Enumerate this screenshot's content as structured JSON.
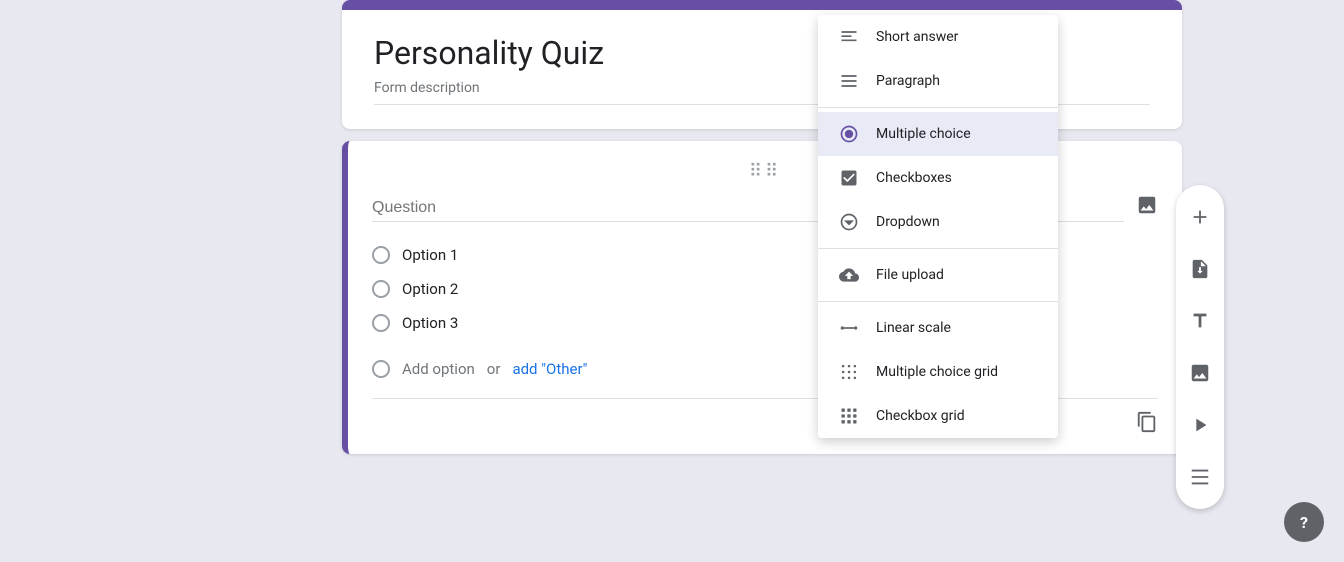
{
  "header": {
    "title": "Personality Quiz",
    "description": "Form description"
  },
  "question": {
    "placeholder": "Question",
    "drag_dots": "⠿",
    "options": [
      {
        "label": "Option 1"
      },
      {
        "label": "Option 2"
      },
      {
        "label": "Option 3"
      }
    ],
    "add_option_text": "Add option",
    "add_option_or": "or",
    "add_other_text": "add \"Other\""
  },
  "dropdown_menu": {
    "items": [
      {
        "id": "short-answer",
        "label": "Short answer",
        "icon": "short-answer-icon"
      },
      {
        "id": "paragraph",
        "label": "Paragraph",
        "icon": "paragraph-icon"
      },
      {
        "id": "multiple-choice",
        "label": "Multiple choice",
        "icon": "multiple-choice-icon",
        "selected": true
      },
      {
        "id": "checkboxes",
        "label": "Checkboxes",
        "icon": "checkboxes-icon"
      },
      {
        "id": "dropdown",
        "label": "Dropdown",
        "icon": "dropdown-icon"
      },
      {
        "id": "file-upload",
        "label": "File upload",
        "icon": "file-upload-icon"
      },
      {
        "id": "linear-scale",
        "label": "Linear scale",
        "icon": "linear-scale-icon"
      },
      {
        "id": "multiple-choice-grid",
        "label": "Multiple choice grid",
        "icon": "grid-icon"
      },
      {
        "id": "checkbox-grid",
        "label": "Checkbox grid",
        "icon": "checkbox-grid-icon"
      }
    ]
  },
  "toolbar": {
    "add_question": "Add question",
    "add_title": "Add title",
    "add_image": "Add image",
    "add_video": "Add video",
    "add_section": "Add section"
  },
  "help": {
    "label": "?"
  }
}
